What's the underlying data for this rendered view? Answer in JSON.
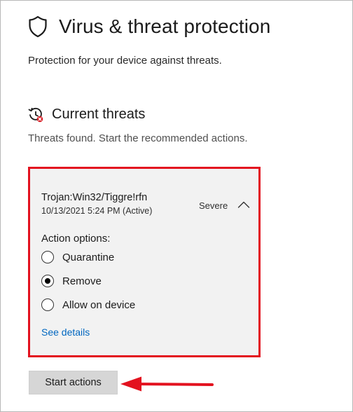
{
  "header": {
    "icon": "shield-icon",
    "title": "Virus & threat protection",
    "subtitle": "Protection for your device against threats."
  },
  "current_threats": {
    "icon": "threat-history-icon",
    "title": "Current threats",
    "description": "Threats found. Start the recommended actions."
  },
  "threat": {
    "name": "Trojan:Win32/Tiggre!rfn",
    "timestamp": "10/13/2021 5:24 PM (Active)",
    "severity": "Severe",
    "expanded": true,
    "action_options_label": "Action options:",
    "options": [
      {
        "label": "Quarantine",
        "selected": false
      },
      {
        "label": "Remove",
        "selected": true
      },
      {
        "label": "Allow on device",
        "selected": false
      }
    ],
    "see_details_label": "See details"
  },
  "start_actions_label": "Start actions",
  "colors": {
    "highlight_border": "#e3121f",
    "link": "#0067c0",
    "annotation_arrow": "#e3121f"
  }
}
